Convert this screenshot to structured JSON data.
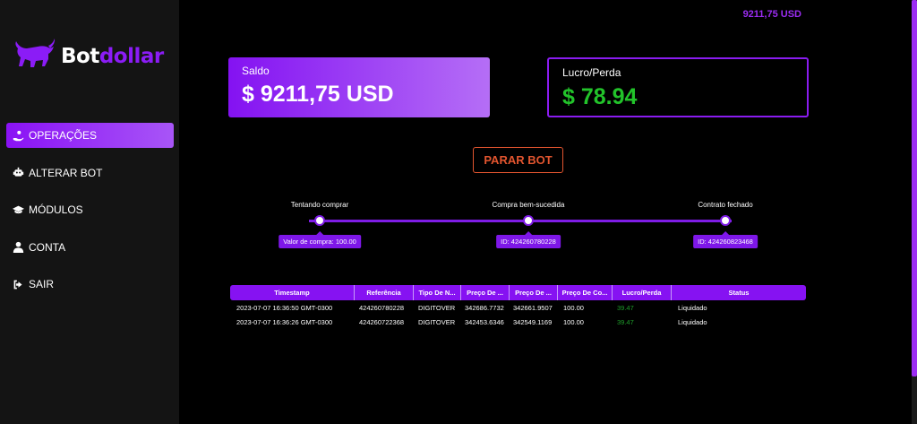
{
  "brand": {
    "name_part1": "Bot",
    "name_part2": "dollar",
    "icon": "bull-icon"
  },
  "top_balance": "9211,75 USD",
  "sidebar": {
    "items": [
      {
        "label": "OPERAÇÕES",
        "icon": "hand-coin-icon",
        "active": true
      },
      {
        "label": "ALTERAR BOT",
        "icon": "robot-icon",
        "active": false
      },
      {
        "label": "MÓDULOS",
        "icon": "graduation-cap-icon",
        "active": false
      },
      {
        "label": "CONTA",
        "icon": "user-icon",
        "active": false
      },
      {
        "label": "SAIR",
        "icon": "sign-out-icon",
        "active": false
      }
    ]
  },
  "cards": {
    "saldo": {
      "label": "Saldo",
      "value": "$ 9211,75 USD"
    },
    "lucro": {
      "label": "Lucro/Perda",
      "value": "$ 78.94"
    }
  },
  "stop_button": "PARAR BOT",
  "steps": [
    {
      "label": "Tentando comprar",
      "tag": "Valor de compra: 100.00"
    },
    {
      "label": "Compra bem-sucedida",
      "tag": "ID: 424260780228"
    },
    {
      "label": "Contrato fechado",
      "tag": "ID: 424260823468"
    }
  ],
  "table": {
    "headers": [
      "Timestamp",
      "Referência",
      "Tipo De N...",
      "Preço De ...",
      "Preço De ...",
      "Preço De Co...",
      "Lucro/Perda",
      "Status"
    ],
    "rows": [
      [
        "2023-07-07 16:36:50 GMT-0300",
        "424260780228",
        "DIGITOVER",
        "342686.7732",
        "342661.9507",
        "100.00",
        "39.47",
        "Liquidado"
      ],
      [
        "2023-07-07 16:36:26 GMT-0300",
        "424260722368",
        "DIGITOVER",
        "342453.6346",
        "342549.1169",
        "100.00",
        "39.47",
        "Liquidado"
      ]
    ]
  },
  "colors": {
    "accent": "#8612f2",
    "profit": "#22c32a",
    "stop": "#e2552f"
  }
}
